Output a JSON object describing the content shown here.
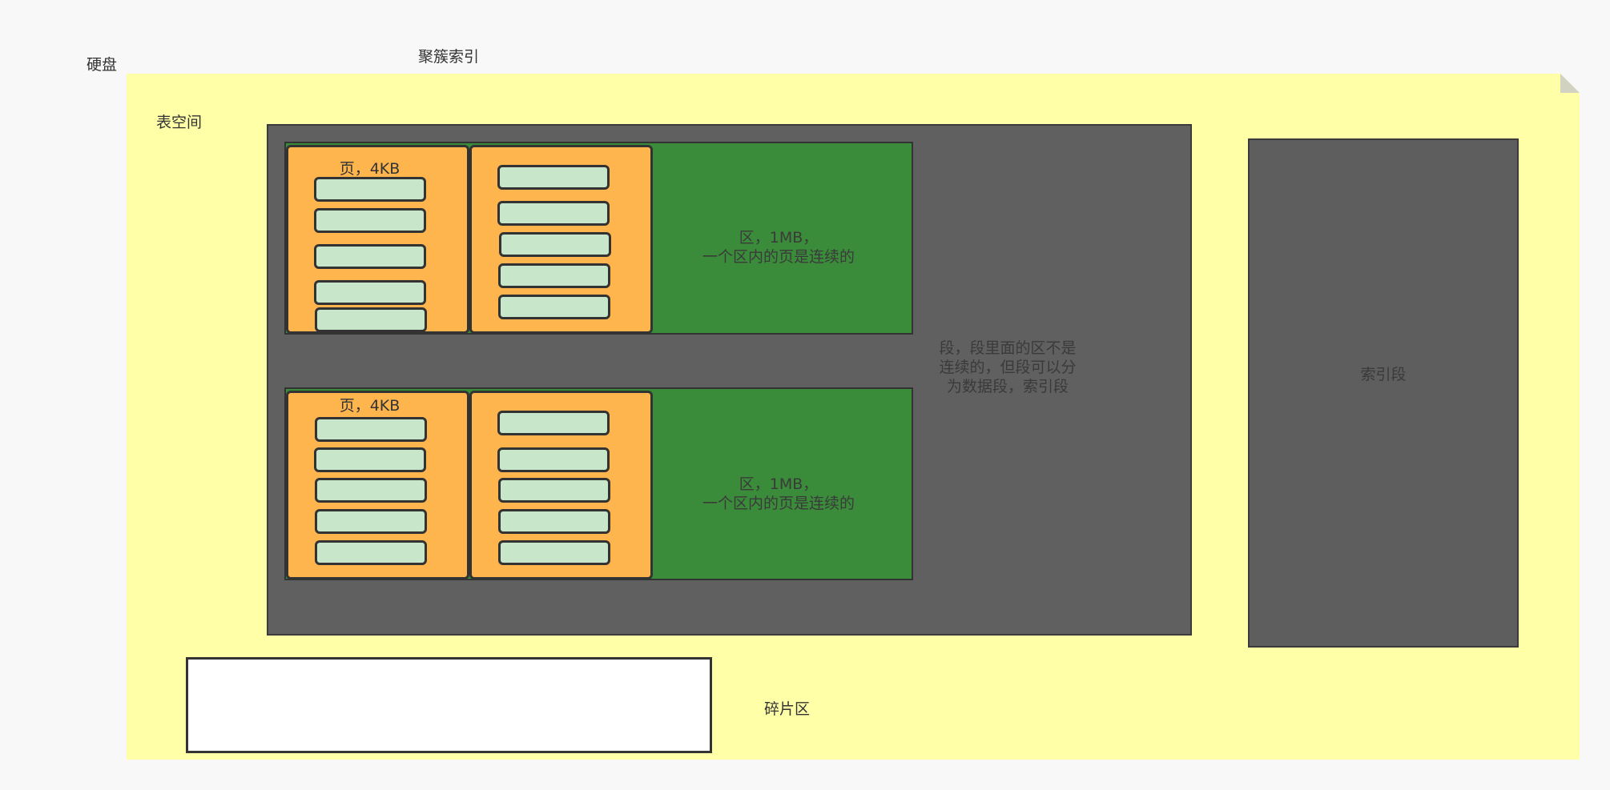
{
  "labels": {
    "disk": "硬盘",
    "clustered_index": "聚簇索引",
    "tablespace": "表空间",
    "segment": "段，段里面的区不是连续的，但段可以分为数据段，索引段",
    "index_segment": "索引段",
    "fragment_area": "碎片区"
  },
  "extents": [
    {
      "text": "区，1MB，\n一个区内的页是连续的",
      "page_label": "页，4KB"
    },
    {
      "text": "区，1MB，\n一个区内的页是连续的",
      "page_label": "页，4KB"
    }
  ],
  "colors": {
    "background": "#f8f8f8",
    "tablespace": "#ffffa8",
    "segment": "#606060",
    "extent": "#3a8c3a",
    "page": "#ffb54d",
    "row": "#c8e6c9"
  }
}
